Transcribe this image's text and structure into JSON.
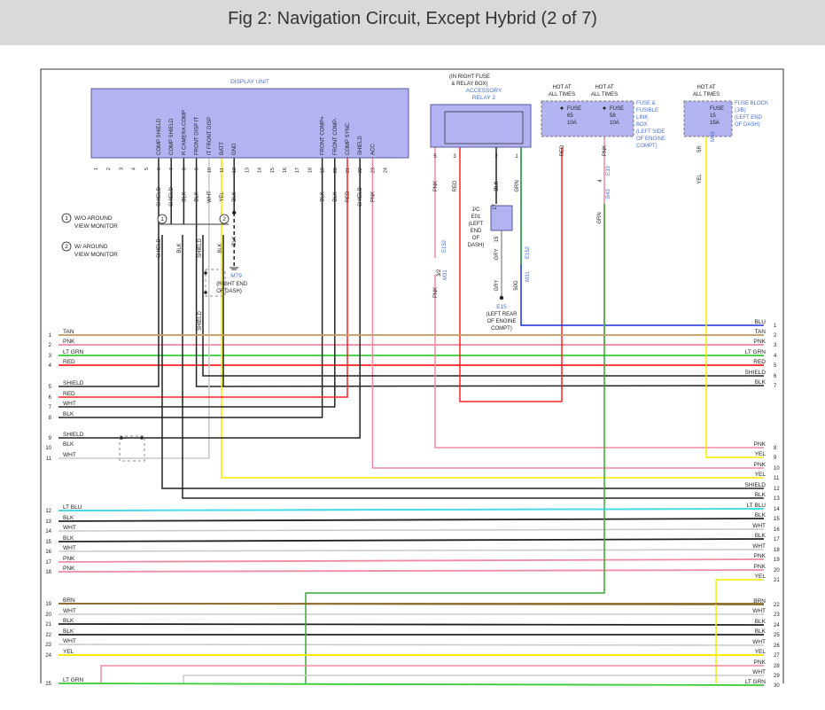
{
  "title": "Fig 2: Navigation Circuit, Except Hybrid (2 of 7)",
  "colors": {
    "module_fill": "#b3b3f2",
    "module_stroke": "#5a5a9a",
    "label_blue": "#4a6fd6",
    "RED": "#ff2020",
    "PNK": "#f08aa0",
    "TAN": "#c9a36a",
    "LTGRN": "#33cc33",
    "GRN": "#33aa33",
    "BLK": "#222222",
    "SHIELD": "#222222",
    "WHT": "#c8c8c8",
    "YEL": "#f5ea00",
    "BLU": "#1a2ee6",
    "LTBLU": "#44d9e6",
    "BRN": "#8a6a2a",
    "GRY": "#999999"
  },
  "display_unit": {
    "title": "DISPLAY UNIT",
    "pin_numbers": [
      "1",
      "2",
      "3",
      "4",
      "5",
      "6",
      "7",
      "8",
      "9",
      "10",
      "11",
      "12",
      "13",
      "14",
      "15",
      "16",
      "17",
      "18",
      "19",
      "20",
      "21",
      "22",
      "23",
      "24"
    ],
    "pin_names": [
      {
        "pin": "6",
        "name": "COMP SHIELD"
      },
      {
        "pin": "7",
        "name": "COMP SHIELD"
      },
      {
        "pin": "8",
        "name": "R CAMERA COMP"
      },
      {
        "pin": "9",
        "name": "FRONT DISP IT"
      },
      {
        "pin": "10",
        "name": "IT FRONT DISP"
      },
      {
        "pin": "11",
        "name": "BATT"
      },
      {
        "pin": "12",
        "name": "GND"
      },
      {
        "pin": "19",
        "name": "FRONT COMP+"
      },
      {
        "pin": "20",
        "name": "FRONT COMP-"
      },
      {
        "pin": "21",
        "name": "COMP SYNC"
      },
      {
        "pin": "22",
        "name": "SHIELD"
      },
      {
        "pin": "23",
        "name": "ACC"
      }
    ],
    "wire_labels": [
      {
        "pin": "6",
        "color": "SHIELD"
      },
      {
        "pin": "7",
        "color": "SHIELD"
      },
      {
        "pin": "8",
        "color": "BLK"
      },
      {
        "pin": "9",
        "color": "BLK"
      },
      {
        "pin": "10",
        "color": "WHT"
      },
      {
        "pin": "11",
        "color": "YEL"
      },
      {
        "pin": "12",
        "color": "BLK"
      },
      {
        "pin": "19",
        "color": "BLK"
      },
      {
        "pin": "20",
        "color": "BLK"
      },
      {
        "pin": "21",
        "color": "RED"
      },
      {
        "pin": "22",
        "color": "SHIELD"
      },
      {
        "pin": "23",
        "color": "PNK"
      }
    ]
  },
  "legend": [
    {
      "num": "1",
      "text": [
        "W/O AROUND",
        "VIEW MONITOR"
      ]
    },
    {
      "num": "2",
      "text": [
        "W/ AROUND",
        "VIEW MONITOR"
      ]
    }
  ],
  "branch_labels": {
    "option1": [
      "SHIELD",
      "BLK"
    ],
    "option2": [
      "SHIELD",
      "BLK"
    ],
    "lower_shield": "SHIELD"
  },
  "ground": {
    "id": "M79",
    "wire": "BLK",
    "location": [
      "(RIGHT END",
      "OF DASH)"
    ]
  },
  "relay": {
    "location": [
      "(IN RIGHT FUSE",
      "& RELAY BOX)"
    ],
    "name": [
      "ACCESSORY",
      "RELAY 2"
    ],
    "pins": [
      "5",
      "3",
      "2",
      "1"
    ],
    "wire_colors": [
      "PNK",
      "RED",
      "BLK",
      "GRN"
    ]
  },
  "fuses": [
    {
      "hot": [
        "HOT AT",
        "ALL TIMES"
      ],
      "label": [
        "FUSE",
        "65",
        "10A"
      ],
      "wire": "RED"
    },
    {
      "hot": [
        "HOT AT",
        "ALL TIMES"
      ],
      "label": [
        "FUSE",
        "58",
        "10A"
      ],
      "wire": "PNK"
    }
  ],
  "fusible_box": [
    "FUSE &",
    "FUSIBLE",
    "LINK",
    "BOX",
    "(LEFT SIDE",
    "OF ENGINE",
    "COMPT)"
  ],
  "fuse_block": {
    "hot": [
      "HOT AT",
      "ALL TIMES"
    ],
    "label": [
      "FUSE",
      "15",
      "15A"
    ],
    "name": [
      "FUSE BLOCK",
      "(J/B)",
      "(LEFT END",
      "OF DASH)"
    ],
    "pin": "5R",
    "connector": "M68",
    "wire": "YEL"
  },
  "connectors": {
    "e33": {
      "pin": "4",
      "id": "E33"
    },
    "b43": {
      "id": "B43",
      "wire": "GRN"
    },
    "e152_left": {
      "pin": "3/2",
      "id": "E152"
    },
    "m31_left": {
      "id": "M31",
      "wire": "PNK"
    },
    "e152_right": {
      "id": "E152"
    },
    "m31_right": {
      "id": "M31"
    },
    "jc_e01": {
      "name": [
        "J/C",
        "E01",
        "(LEFT",
        "END",
        "OF",
        "DASH)"
      ],
      "pins": [
        "17",
        "15"
      ],
      "wires": [
        "BLK",
        "GRY"
      ]
    },
    "e15": {
      "id": "E15",
      "pin": "50G",
      "wire": "GRY",
      "location": [
        "(LEFT REAR",
        "OF ENGINE",
        "COMPT)"
      ]
    }
  },
  "left_bus": [
    {
      "n": "1",
      "color": "TAN"
    },
    {
      "n": "2",
      "color": "PNK"
    },
    {
      "n": "3",
      "color": "LT GRN"
    },
    {
      "n": "4",
      "color": "RED"
    },
    {
      "n": "5",
      "color": "SHIELD"
    },
    {
      "n": "6",
      "color": "RED"
    },
    {
      "n": "7",
      "color": "WHT"
    },
    {
      "n": "8",
      "color": "BLK"
    },
    {
      "n": "9",
      "color": "SHIELD"
    },
    {
      "n": "10",
      "color": "BLK"
    },
    {
      "n": "11",
      "color": "WHT"
    },
    {
      "n": "12",
      "color": "LT BLU"
    },
    {
      "n": "13",
      "color": "BLK"
    },
    {
      "n": "14",
      "color": "WHT"
    },
    {
      "n": "15",
      "color": "BLK"
    },
    {
      "n": "16",
      "color": "WHT"
    },
    {
      "n": "17",
      "color": "PNK"
    },
    {
      "n": "18",
      "color": "PNK"
    },
    {
      "n": "19",
      "color": "BRN"
    },
    {
      "n": "20",
      "color": "WHT"
    },
    {
      "n": "21",
      "color": "BLK"
    },
    {
      "n": "22",
      "color": "BLK"
    },
    {
      "n": "23",
      "color": "WHT"
    },
    {
      "n": "24",
      "color": "YEL"
    },
    {
      "n": "25",
      "color": "LT GRN"
    }
  ],
  "right_bus": [
    {
      "n": "1",
      "color": "BLU"
    },
    {
      "n": "2",
      "color": "TAN"
    },
    {
      "n": "3",
      "color": "PNK"
    },
    {
      "n": "4",
      "color": "LT GRN"
    },
    {
      "n": "5",
      "color": "RED"
    },
    {
      "n": "6",
      "color": "SHIELD"
    },
    {
      "n": "7",
      "color": "BLK"
    },
    {
      "n": "8",
      "color": "PNK"
    },
    {
      "n": "9",
      "color": "YEL"
    },
    {
      "n": "10",
      "color": "PNK"
    },
    {
      "n": "11",
      "color": "YEL"
    },
    {
      "n": "12",
      "color": "SHIELD"
    },
    {
      "n": "13",
      "color": "BLK"
    },
    {
      "n": "14",
      "color": "LT BLU"
    },
    {
      "n": "15",
      "color": "BLK"
    },
    {
      "n": "16",
      "color": "WHT"
    },
    {
      "n": "17",
      "color": "BLK"
    },
    {
      "n": "18",
      "color": "WHT"
    },
    {
      "n": "19",
      "color": "PNK"
    },
    {
      "n": "20",
      "color": "PNK"
    },
    {
      "n": "21",
      "color": "YEL"
    },
    {
      "n": "22",
      "color": "BRN"
    },
    {
      "n": "23",
      "color": "WHT"
    },
    {
      "n": "24",
      "color": "BLK"
    },
    {
      "n": "25",
      "color": "BLK"
    },
    {
      "n": "26",
      "color": "WHT"
    },
    {
      "n": "27",
      "color": "YEL"
    },
    {
      "n": "28",
      "color": "PNK"
    },
    {
      "n": "29",
      "color": "WHT"
    },
    {
      "n": "30",
      "color": "LT GRN"
    }
  ]
}
